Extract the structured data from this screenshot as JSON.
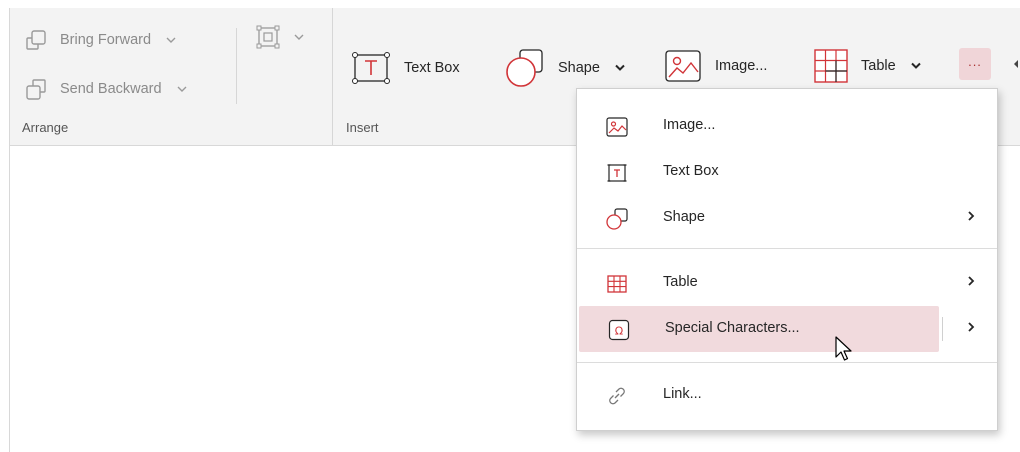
{
  "ribbon": {
    "arrange": {
      "group_label": "Arrange",
      "bring_forward": "Bring Forward",
      "send_backward": "Send Backward"
    },
    "insert": {
      "group_label": "Insert",
      "text_box": "Text Box",
      "shape": "Shape",
      "image": "Image...",
      "table": "Table",
      "more": "..."
    }
  },
  "menu": {
    "items": [
      {
        "label": "Image...",
        "icon": "image-icon",
        "has_submenu": false
      },
      {
        "label": "Text Box",
        "icon": "text-box-icon",
        "has_submenu": false
      },
      {
        "label": "Shape",
        "icon": "shape-icon",
        "has_submenu": true
      },
      {
        "label": "Table",
        "icon": "table-icon",
        "has_submenu": true
      },
      {
        "label": "Special Characters...",
        "icon": "special-characters-icon",
        "has_submenu": true,
        "highlighted": true
      },
      {
        "label": "Link...",
        "icon": "link-icon",
        "has_submenu": false
      }
    ]
  },
  "colors": {
    "accent": "#d13438",
    "hover": "#f1dadd",
    "ribbon_bg": "#f3f3f3"
  }
}
